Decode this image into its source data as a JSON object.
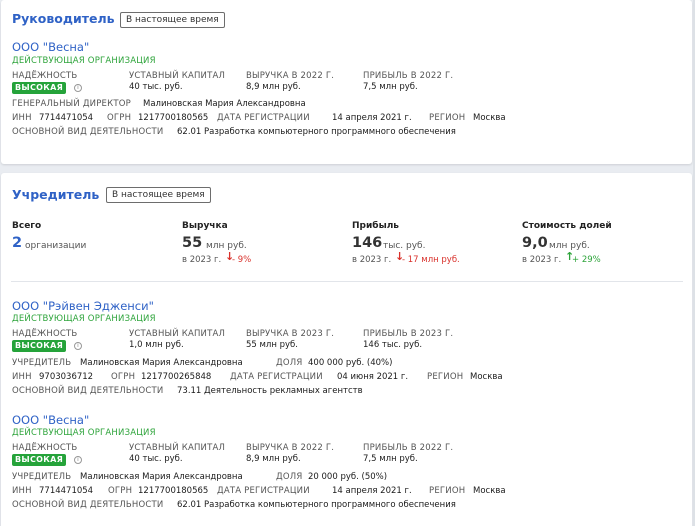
{
  "manager_section": {
    "title": "Руководитель",
    "period": "В настоящее время",
    "company": {
      "name": "ООО \"Весна\"",
      "status": "ДЕЙСТВУЮЩАЯ ОРГАНИЗАЦИЯ",
      "reliability_label": "НАДЁЖНОСТЬ",
      "reliability_value": "ВЫСОКАЯ",
      "capital_label": "УСТАВНЫЙ КАПИТАЛ",
      "capital_value": "40 тыс. руб.",
      "revenue_label": "ВЫРУЧКА В 2022 Г.",
      "revenue_value": "8,9 млн руб.",
      "profit_label": "ПРИБЫЛЬ В 2022 Г.",
      "profit_value": "7,5 млн руб.",
      "director_label": "ГЕНЕРАЛЬНЫЙ ДИРЕКТОР",
      "director_value": "Малиновская Мария Александровна",
      "inn_label": "ИНН",
      "inn_value": "7714471054",
      "ogrn_label": "ОГРН",
      "ogrn_value": "1217700180565",
      "regdate_label": "ДАТА РЕГИСТРАЦИИ",
      "regdate_value": "14 апреля 2021 г.",
      "region_label": "РЕГИОН",
      "region_value": "Москва",
      "activity_label": "ОСНОВНОЙ ВИД ДЕЯТЕЛЬНОСТИ",
      "activity_value": "62.01 Разработка компьютерного программного обеспечения"
    }
  },
  "founder_section": {
    "title": "Учредитель",
    "period": "В настоящее время",
    "stats": {
      "total": {
        "head": "Всего",
        "value": "2",
        "unit": "организации"
      },
      "revenue": {
        "head": "Выручка",
        "value": "55",
        "unit": "млн руб.",
        "sub": "в 2023 г.",
        "change": "- 9%",
        "direction": "down"
      },
      "profit": {
        "head": "Прибыль",
        "value": "146",
        "unit": "тыс. руб.",
        "sub": "в 2023 г.",
        "change": "- 17 млн руб.",
        "direction": "down"
      },
      "shares": {
        "head": "Стоимость долей",
        "value": "9,0",
        "unit": "млн руб.",
        "sub": "в 2023 г.",
        "change": "+ 29%",
        "direction": "up"
      }
    },
    "companies": [
      {
        "name": "ООО \"Рэйвен Эдженси\"",
        "status": "ДЕЙСТВУЮЩАЯ ОРГАНИЗАЦИЯ",
        "reliability_label": "НАДЁЖНОСТЬ",
        "reliability_value": "ВЫСОКАЯ",
        "capital_label": "УСТАВНЫЙ КАПИТАЛ",
        "capital_value": "1,0 млн руб.",
        "revenue_label": "ВЫРУЧКА В 2023 Г.",
        "revenue_value": "55 млн руб.",
        "profit_label": "ПРИБЫЛЬ В 2023 Г.",
        "profit_value": "146 тыс. руб.",
        "founder_label": "УЧРЕДИТЕЛЬ",
        "founder_value": "Малиновская Мария Александровна",
        "share_label": "ДОЛЯ",
        "share_value": "400 000 руб. (40%)",
        "inn_label": "ИНН",
        "inn_value": "9703036712",
        "ogrn_label": "ОГРН",
        "ogrn_value": "1217700265848",
        "regdate_label": "ДАТА РЕГИСТРАЦИИ",
        "regdate_value": "04 июня 2021 г.",
        "region_label": "РЕГИОН",
        "region_value": "Москва",
        "activity_label": "ОСНОВНОЙ ВИД ДЕЯТЕЛЬНОСТИ",
        "activity_value": "73.11 Деятельность рекламных агентств"
      },
      {
        "name": "ООО \"Весна\"",
        "status": "ДЕЙСТВУЮЩАЯ ОРГАНИЗАЦИЯ",
        "reliability_label": "НАДЁЖНОСТЬ",
        "reliability_value": "ВЫСОКАЯ",
        "capital_label": "УСТАВНЫЙ КАПИТАЛ",
        "capital_value": "40 тыс. руб.",
        "revenue_label": "ВЫРУЧКА В 2022 Г.",
        "revenue_value": "8,9 млн руб.",
        "profit_label": "ПРИБЫЛЬ В 2022 Г.",
        "profit_value": "7,5 млн руб.",
        "founder_label": "УЧРЕДИТЕЛЬ",
        "founder_value": "Малиновская Мария Александровна",
        "share_label": "ДОЛЯ",
        "share_value": "20 000 руб. (50%)",
        "inn_label": "ИНН",
        "inn_value": "7714471054",
        "ogrn_label": "ОГРН",
        "ogrn_value": "1217700180565",
        "regdate_label": "ДАТА РЕГИСТРАЦИИ",
        "regdate_value": "14 апреля 2021 г.",
        "region_label": "РЕГИОН",
        "region_value": "Москва",
        "activity_label": "ОСНОВНОЙ ВИД ДЕЯТЕЛЬНОСТИ",
        "activity_value": "62.01 Разработка компьютерного программного обеспечения"
      }
    ]
  },
  "icons": {
    "info": "info-icon",
    "arrow_down": "arrow-down-icon",
    "arrow_up": "arrow-up-icon"
  },
  "colors": {
    "accent": "#2f62c6",
    "status_green": "#2ea43b",
    "badge_green": "#25a33a",
    "negative": "#d9312b"
  }
}
